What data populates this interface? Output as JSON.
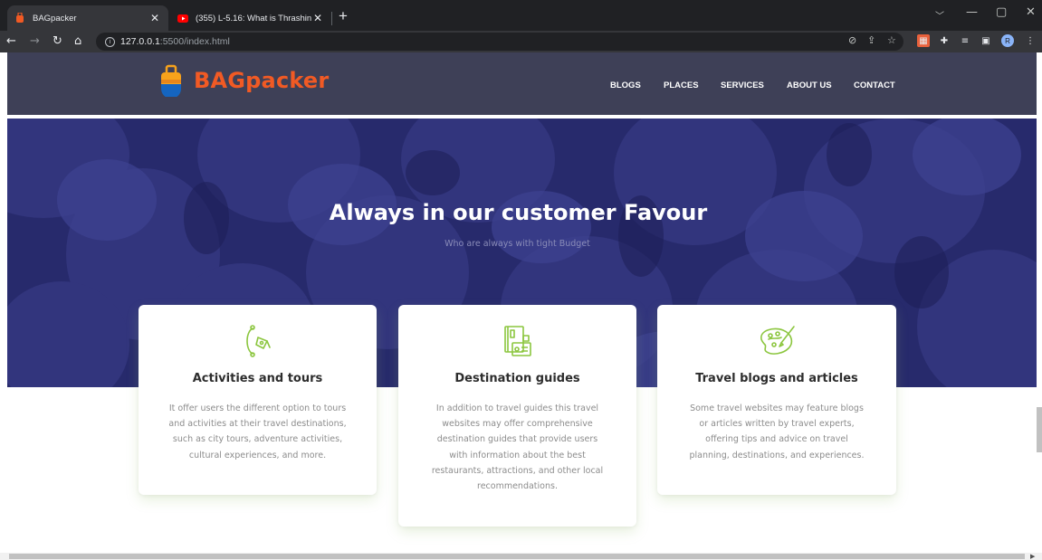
{
  "browser": {
    "tabs": [
      {
        "title": "BAGpacker",
        "active": true,
        "favicon": "bag-favicon-icon"
      },
      {
        "title": "(355) L-5.16: What is Thrashing |",
        "active": false,
        "favicon": "youtube-icon"
      }
    ],
    "url_host": "127.0.0.1",
    "url_rest": ":5500/index.html",
    "profile_initial": "R"
  },
  "site": {
    "logo_text": "BAGpacker",
    "nav": [
      "BLOGS",
      "PLACES",
      "SERVICES",
      "ABOUT US",
      "CONTACT"
    ],
    "hero_title": "Always in our customer Favour",
    "hero_subtitle": "Who are always with tight Budget",
    "cards": [
      {
        "icon": "pen-tool-icon",
        "title": "Activities and tours",
        "lines": [
          "It offer users the different option to tours",
          "and activities at their travel destinations,",
          "such as city tours, adventure activities,",
          "cultural experiences, and more."
        ]
      },
      {
        "icon": "guide-document-icon",
        "title": "Destination guides",
        "lines": [
          "In addition to travel guides this travel",
          "websites may offer comprehensive",
          "destination guides that provide users",
          "with information about the best",
          "restaurants, attractions, and other local",
          "recommendations."
        ]
      },
      {
        "icon": "paint-palette-icon",
        "title": "Travel blogs and articles",
        "lines": [
          "Some travel websites may feature blogs",
          "or articles written by travel experts,",
          "offering tips and advice on travel",
          "planning, destinations, and experiences."
        ]
      }
    ]
  },
  "colors": {
    "header_bg": "#3e4057",
    "brand": "#f15a24",
    "hero_bg": "#262868",
    "icon_green": "#8cc63f"
  }
}
